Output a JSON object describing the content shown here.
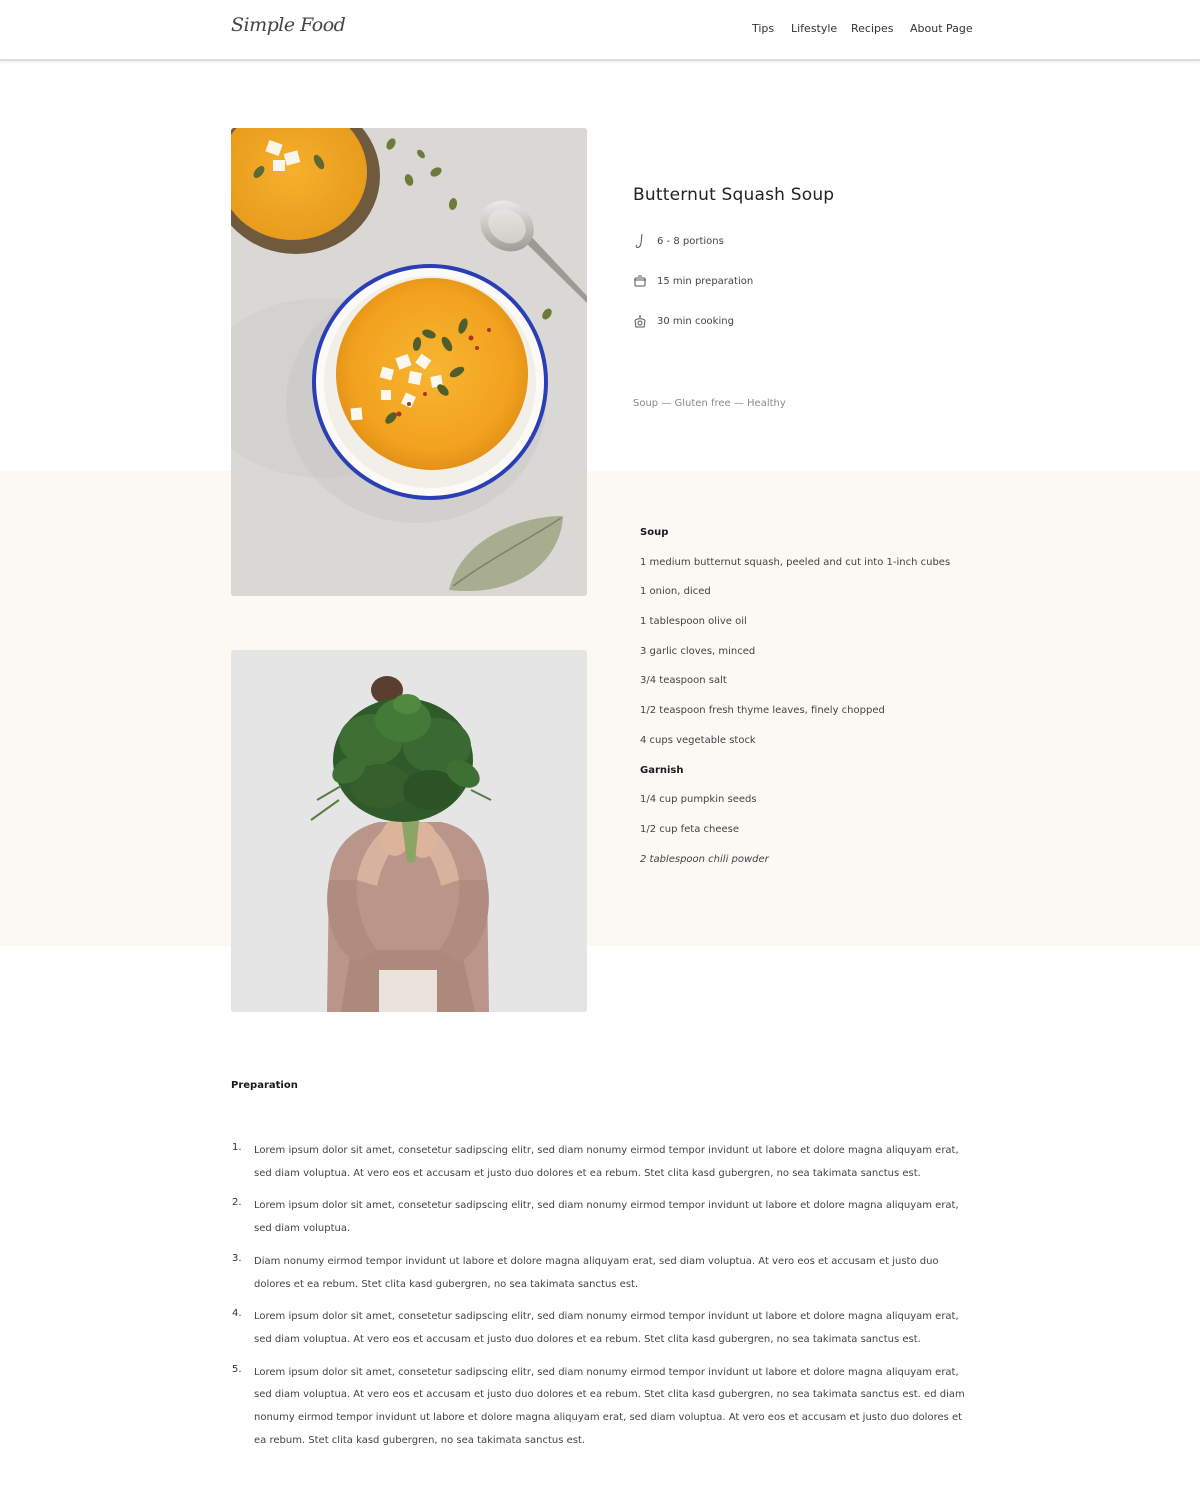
{
  "header": {
    "logo_text": "Simple Food",
    "nav": [
      "Tips",
      "Lifestyle",
      "Recipes",
      "About Page"
    ]
  },
  "recipe": {
    "title": "Butternut Squash Soup",
    "meta": {
      "portions": "6 - 8 portions",
      "preparation": "15 min preparation",
      "cooking": "30 min cooking"
    },
    "tags": "Soup — Gluten free — Healthy"
  },
  "ingredients": {
    "soup_heading": "Soup",
    "soup_items": [
      "1 medium butternut squash, peeled and cut into 1-inch cubes",
      "1 onion, diced",
      "1 tablespoon olive oil",
      "3 garlic cloves, minced",
      "3/4 teaspoon salt",
      "1/2 teaspoon fresh thyme leaves, finely chopped",
      "4 cups vegetable stock"
    ],
    "garnish_heading": "Garnish",
    "garnish_items": [
      "1/4 cup pumpkin seeds",
      "1/2 cup feta cheese",
      "2 tablespoon chili powder"
    ]
  },
  "preparation": {
    "heading": "Preparation",
    "steps": [
      {
        "num": "1.",
        "text": "Lorem ipsum dolor sit amet, consetetur sadipscing elitr, sed diam nonumy eirmod tempor invidunt ut labore et dolore magna aliquyam erat, sed diam voluptua. At vero eos et accusam et   justo duo dolores et ea rebum. Stet clita kasd gubergren, no sea takimata sanctus est."
      },
      {
        "num": "2.",
        "text": "Lorem ipsum dolor sit amet, consetetur sadipscing elitr, sed diam nonumy eirmod tempor invidunt ut labore et dolore magna aliquyam erat, sed diam voluptua."
      },
      {
        "num": "3.",
        "text": "Diam nonumy eirmod tempor invidunt ut labore et dolore magna aliquyam erat, sed diam voluptua. At vero eos et accusam et justo duo dolores et ea rebum. Stet clita kasd gubergren, no sea takimata sanctus est."
      },
      {
        "num": "4.",
        "text": "Lorem ipsum dolor sit amet, consetetur sadipscing elitr, sed diam nonumy eirmod tempor invidunt ut labore et dolore magna aliquyam erat, sed diam voluptua. At vero eos et accusam et justo duo dolores et ea rebum. Stet clita kasd gubergren, no sea takimata sanctus est."
      },
      {
        "num": "5.",
        "text": "Lorem ipsum dolor sit amet, consetetur sadipscing elitr, sed diam nonumy eirmod tempor invidunt ut labore et dolore magna aliquyam erat, sed diam voluptua. At vero eos et accusam et justo duo dolores et ea rebum. Stet clita kasd gubergren, no sea takimata sanctus est. ed diam nonumy eirmod tempor invidunt ut labore et dolore magna aliquyam erat, sed diam voluptua. At vero eos et accusam et justo duo dolores et ea rebum. Stet clita kasd gubergren, no sea takimata sanctus est."
      }
    ]
  },
  "colors": {
    "cream_band": "#fcf8f3",
    "soup_orange": "#f2a21f",
    "bowl_rim_blue": "#2a3fb5"
  }
}
